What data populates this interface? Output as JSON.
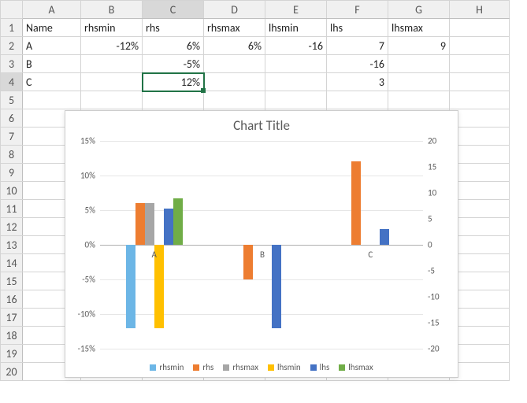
{
  "spreadsheet": {
    "columns": [
      "A",
      "B",
      "C",
      "D",
      "E",
      "F",
      "G",
      "H"
    ],
    "rows": [
      "1",
      "2",
      "3",
      "4",
      "5",
      "6",
      "7",
      "8",
      "9",
      "10",
      "11",
      "12",
      "13",
      "14",
      "15",
      "16",
      "17",
      "18",
      "19",
      "20"
    ],
    "active_col": "C",
    "active_row": "4",
    "headers": {
      "A1": "Name",
      "B1": "rhsmin",
      "C1": "rhs",
      "D1": "rhsmax",
      "E1": "lhsmin",
      "F1": "lhs",
      "G1": "lhsmax"
    },
    "cells": {
      "A2": "A",
      "B2": "-12%",
      "C2": "6%",
      "D2": "6%",
      "E2": "-16",
      "F2": "7",
      "G2": "9",
      "A3": "B",
      "C3": "-5%",
      "F3": "-16",
      "A4": "C",
      "C4": "12%",
      "F4": "3"
    },
    "selected_cell": "C4"
  },
  "chart_data": {
    "type": "bar",
    "title": "Chart Title",
    "categories": [
      "A",
      "B",
      "C"
    ],
    "left_axis": {
      "label": "",
      "min": -15,
      "max": 15,
      "ticks": [
        "-15%",
        "-10%",
        "-5%",
        "0%",
        "5%",
        "10%",
        "15%"
      ],
      "format": "percent"
    },
    "right_axis": {
      "label": "",
      "min": -20,
      "max": 20,
      "ticks": [
        "-20",
        "-15",
        "-10",
        "-5",
        "0",
        "5",
        "10",
        "15",
        "20"
      ]
    },
    "series": [
      {
        "name": "rhsmin",
        "axis": "left",
        "color": "#6cb6e6",
        "values": [
          -12,
          null,
          null
        ]
      },
      {
        "name": "rhs",
        "axis": "left",
        "color": "#ed7d31",
        "values": [
          6,
          -5,
          12
        ]
      },
      {
        "name": "rhsmax",
        "axis": "left",
        "color": "#a6a6a6",
        "values": [
          6,
          null,
          null
        ]
      },
      {
        "name": "lhsmin",
        "axis": "right",
        "color": "#ffc000",
        "values": [
          -16,
          null,
          null
        ]
      },
      {
        "name": "lhs",
        "axis": "right",
        "color": "#4472c4",
        "values": [
          7,
          -16,
          3
        ]
      },
      {
        "name": "lhsmax",
        "axis": "right",
        "color": "#70ad47",
        "values": [
          9,
          null,
          null
        ]
      }
    ],
    "legend": [
      "rhsmin",
      "rhs",
      "rhsmax",
      "lhsmin",
      "lhs",
      "lhsmax"
    ]
  }
}
